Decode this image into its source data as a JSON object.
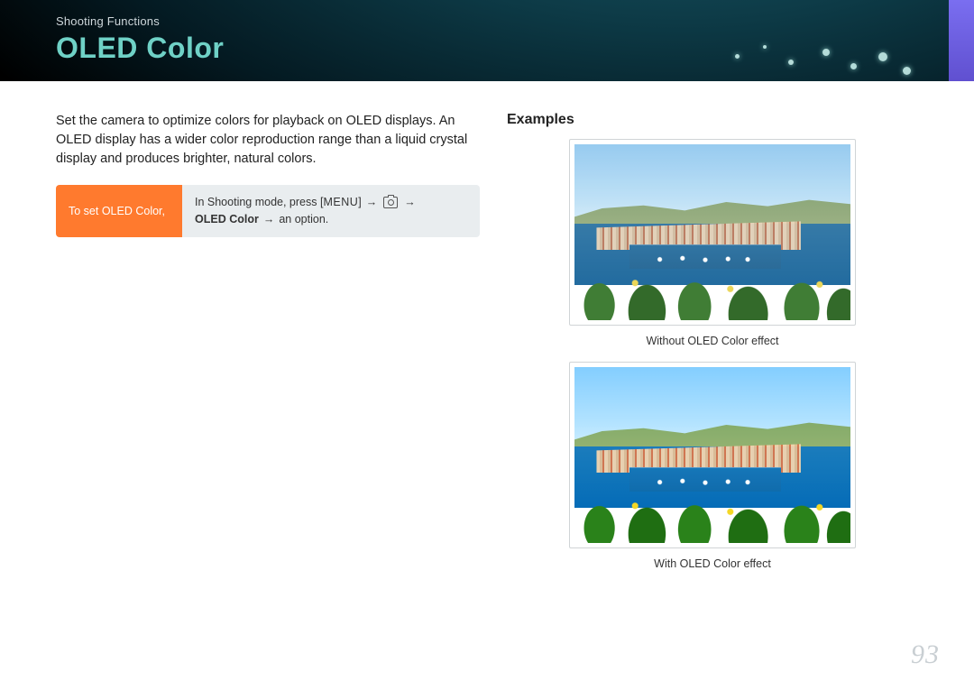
{
  "header": {
    "section": "Shooting Functions",
    "title": "OLED Color"
  },
  "body_text": "Set the camera to optimize colors for playback on OLED displays. An OLED display has a wider color reproduction range than a liquid crystal display and produces brighter, natural colors.",
  "instruction": {
    "label": "To set OLED Color,",
    "prefix": "In Shooting mode, press [",
    "menu_key": "MENU",
    "mid1": "] ",
    "arrow": "→",
    "icon_name": "camera-icon",
    "bold": "OLED Color",
    "suffix": " an option."
  },
  "examples": {
    "heading": "Examples",
    "caption1": "Without OLED Color effect",
    "caption2": "With OLED Color effect"
  },
  "page_number": "93"
}
